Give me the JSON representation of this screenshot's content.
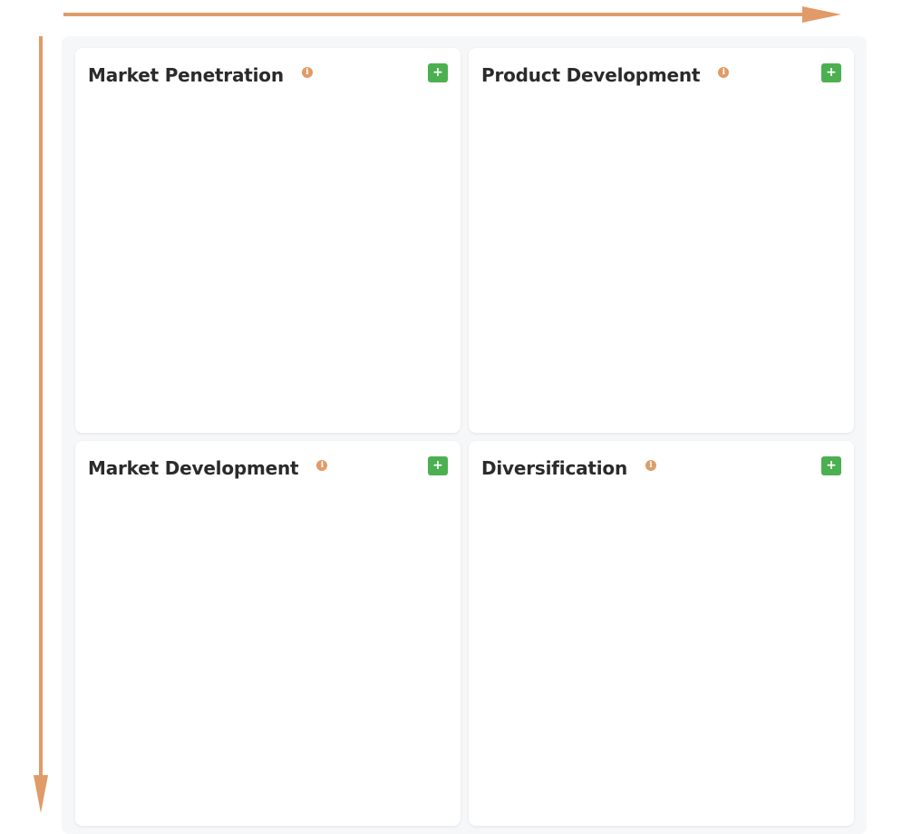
{
  "colors": {
    "axis": "#e09b68",
    "board_bg": "#f6f7f9",
    "card_bg": "#ffffff",
    "add_button": "#4caf50",
    "info_icon": "#e09b68",
    "title_text": "#2b2b2b"
  },
  "quadrants": [
    {
      "title": "Market Penetration",
      "info_icon": "info-icon",
      "add_label": "+"
    },
    {
      "title": "Product Development",
      "info_icon": "info-icon",
      "add_label": "+"
    },
    {
      "title": "Market Development",
      "info_icon": "info-icon",
      "add_label": "+"
    },
    {
      "title": "Diversification",
      "info_icon": "info-icon",
      "add_label": "+"
    }
  ]
}
